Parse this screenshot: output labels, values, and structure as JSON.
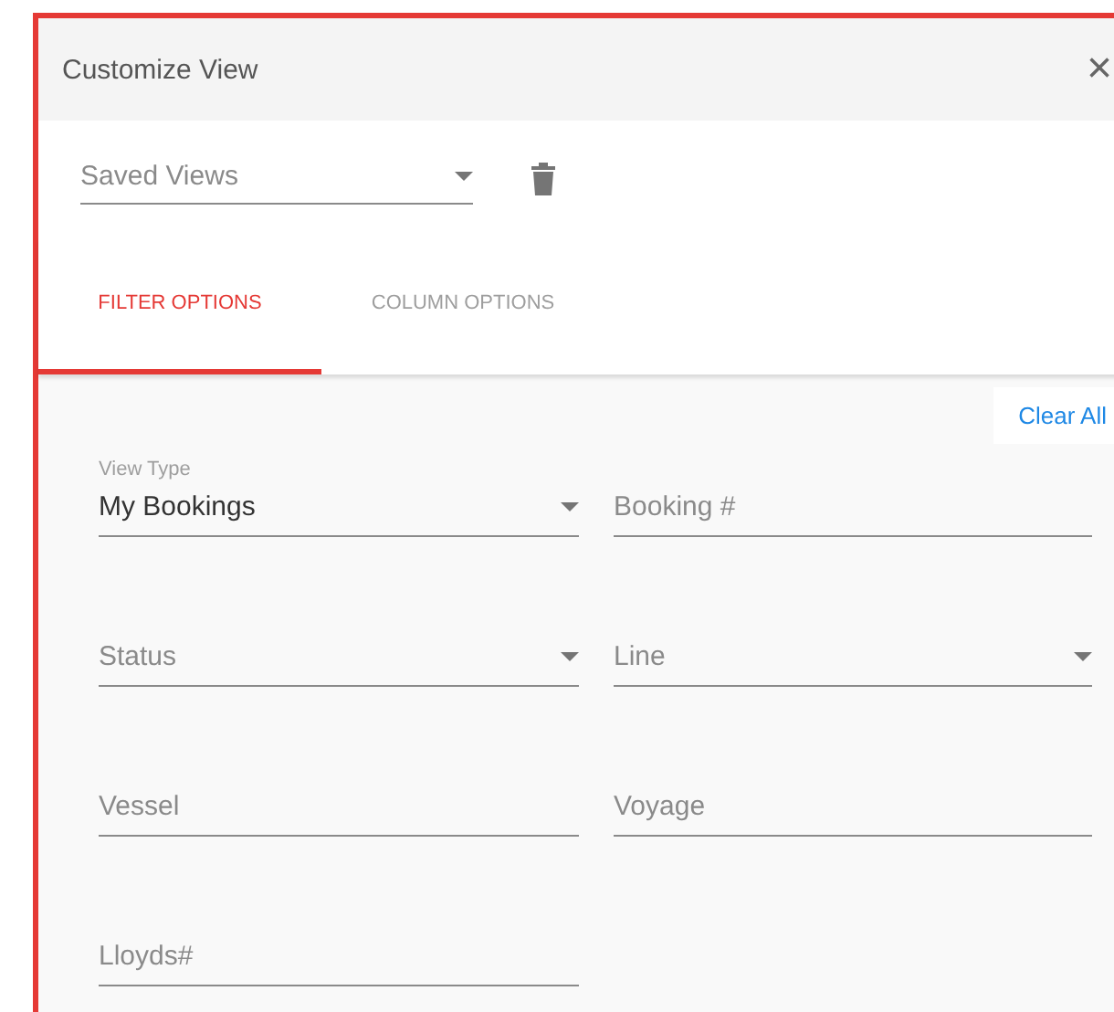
{
  "dialog": {
    "title": "Customize View",
    "close": "×"
  },
  "saved_views": {
    "placeholder": "Saved Views"
  },
  "tabs": [
    {
      "label": "FILTER OPTIONS",
      "selected": true
    },
    {
      "label": "COLUMN OPTIONS",
      "selected": false
    }
  ],
  "clear_all": "Clear All",
  "fields": [
    {
      "kind": "select",
      "label": "View Type",
      "value": "My Bookings"
    },
    {
      "kind": "text",
      "placeholder": "Booking #"
    },
    {
      "kind": "select",
      "placeholder": "Status"
    },
    {
      "kind": "select",
      "placeholder": "Line"
    },
    {
      "kind": "text",
      "placeholder": "Vessel"
    },
    {
      "kind": "text",
      "placeholder": "Voyage"
    },
    {
      "kind": "text",
      "placeholder": "Lloyds#"
    }
  ]
}
